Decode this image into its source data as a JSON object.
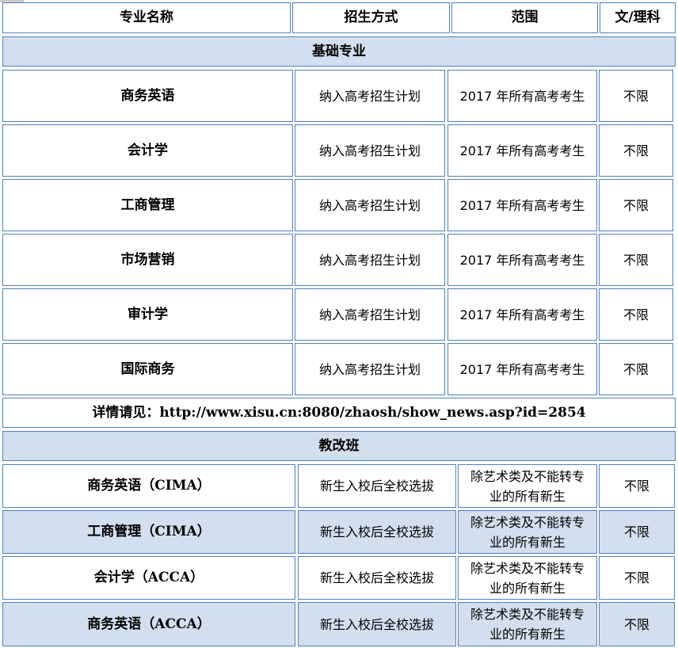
{
  "header": {
    "col_name": "专业名称",
    "col_method": "招生方式",
    "col_scope": "范围",
    "col_stream": "文/理科"
  },
  "section_basic": {
    "title": "基础专业",
    "rows": [
      {
        "name": "商务英语",
        "method": "纳入高考招生计划",
        "scope": "2017 年所有高考考生",
        "stream": "不限"
      },
      {
        "name": "会计学",
        "method": "纳入高考招生计划",
        "scope": "2017 年所有高考考生",
        "stream": "不限"
      },
      {
        "name": "工商管理",
        "method": "纳入高考招生计划",
        "scope": "2017 年所有高考考生",
        "stream": "不限"
      },
      {
        "name": "市场营销",
        "method": "纳入高考招生计划",
        "scope": "2017 年所有高考考生",
        "stream": "不限"
      },
      {
        "name": "审计学",
        "method": "纳入高考招生计划",
        "scope": "2017 年所有高考考生",
        "stream": "不限"
      },
      {
        "name": "国际商务",
        "method": "纳入高考招生计划",
        "scope": "2017 年所有高考考生",
        "stream": "不限"
      }
    ],
    "details": "详情请见：http://www.xisu.cn:8080/zhaosh/show_news.asp?id=2854"
  },
  "section_reform": {
    "title": "教改班",
    "rows": [
      {
        "name": "商务英语（CIMA）",
        "method": "新生入校后全校选拔",
        "scope": "除艺术类及不能转专业的所有新生",
        "stream": "不限"
      },
      {
        "name": "工商管理（CIMA）",
        "method": "新生入校后全校选拔",
        "scope": "除艺术类及不能转专业的所有新生",
        "stream": "不限"
      },
      {
        "name": "会计学（ACCA）",
        "method": "新生入校后全校选拔",
        "scope": "除艺术类及不能转专业的所有新生",
        "stream": "不限"
      },
      {
        "name": "商务英语（ACCA）",
        "method": "新生入校后全校选拔",
        "scope": "除艺术类及不能转专业的所有新生",
        "stream": "不限"
      }
    ]
  },
  "colors": {
    "border": "#4f81bd",
    "shade": "#d3dfee"
  }
}
